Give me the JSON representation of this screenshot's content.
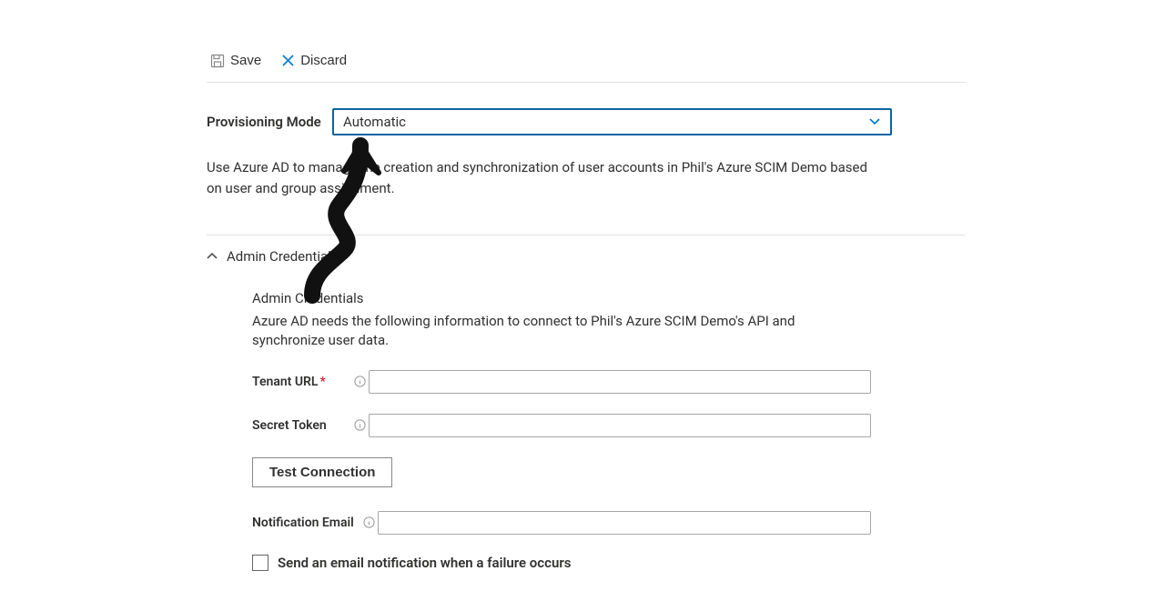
{
  "toolbar": {
    "save_label": "Save",
    "discard_label": "Discard"
  },
  "provisioning": {
    "label": "Provisioning Mode",
    "value": "Automatic",
    "description": "Use Azure AD to manage the creation and synchronization of user accounts in Phil's Azure SCIM Demo based on user and group assignment."
  },
  "admin_section": {
    "collapser_label": "Admin Credentials",
    "title": "Admin Credentials",
    "description": "Azure AD needs the following information to connect to Phil's Azure SCIM Demo's API and synchronize user data.",
    "tenant_url": {
      "label": "Tenant URL",
      "required": true,
      "value": ""
    },
    "secret_token": {
      "label": "Secret Token",
      "required": false,
      "value": ""
    },
    "test_button": "Test Connection",
    "notification_email": {
      "label": "Notification Email",
      "value": ""
    },
    "failure_checkbox": {
      "checked": false,
      "label": "Send an email notification when a failure occurs"
    }
  }
}
